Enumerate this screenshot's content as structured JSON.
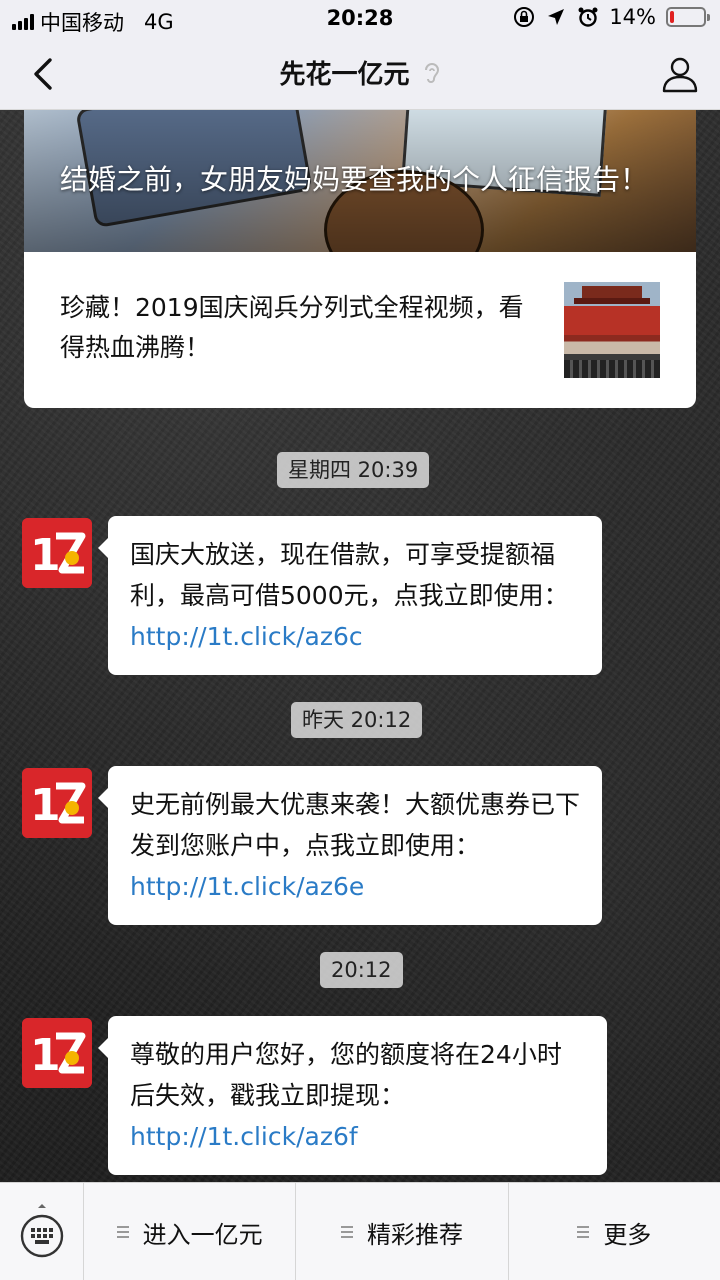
{
  "status_bar": {
    "carrier": "中国移动",
    "network": "4G",
    "time": "20:28",
    "battery_percent": "14%",
    "battery_level": 0.14,
    "icons": [
      "signal-icon",
      "rotation-lock-icon",
      "location-icon",
      "alarm-icon",
      "battery-icon"
    ]
  },
  "nav": {
    "title": "先花一亿元",
    "back_icon": "back-chevron-icon",
    "ear_icon": "earpiece-icon",
    "profile_icon": "profile-icon"
  },
  "article": {
    "cover_title": "结婚之前，女朋友妈妈要查我的个人征信报告！",
    "sub_title": "珍藏！2019国庆阅兵分列式全程视频，看得热血沸腾！"
  },
  "messages": [
    {
      "timestamp": "星期四 20:39",
      "text": "国庆大放送，现在借款，可享受提额福利，最高可借5000元，点我立即使用：",
      "link": "http://1t.click/az6c"
    },
    {
      "timestamp": "昨天 20:12",
      "text": "史无前例最大优惠来袭！大额优惠券已下发到您账户中，点我立即使用：",
      "link": "http://1t.click/az6e"
    },
    {
      "timestamp": "20:12",
      "text": "尊敬的用户您好，您的额度将在24小时后失效，戳我立即提现：",
      "link": "http://1t.click/az6f"
    }
  ],
  "bottom_menu": {
    "keyboard_icon": "keyboard-icon",
    "items": [
      "进入一亿元",
      "精彩推荐",
      "更多"
    ]
  },
  "colors": {
    "link": "#2a7bc6",
    "avatar_red": "#d9262a",
    "battery_low": "#e02020"
  }
}
